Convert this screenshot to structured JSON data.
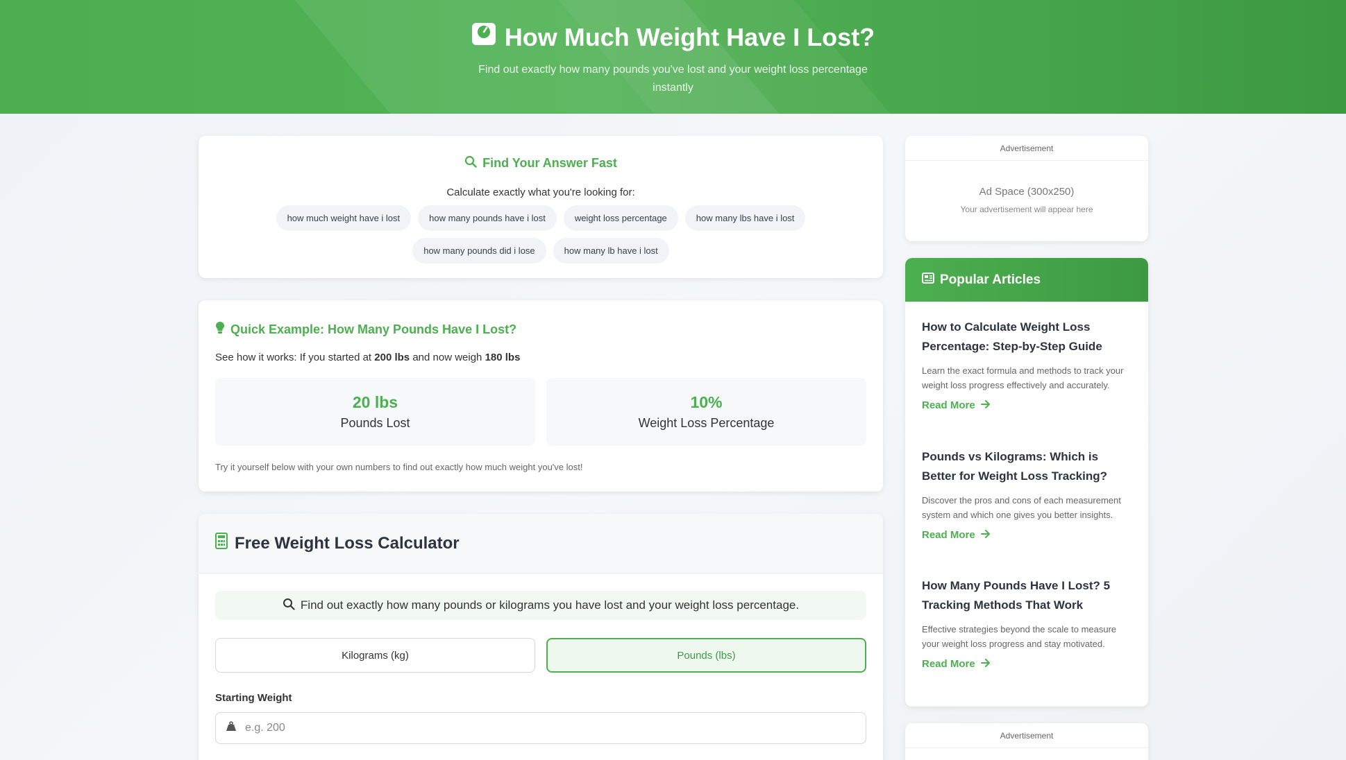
{
  "header": {
    "title": "How Much Weight Have I Lost?",
    "subtitle": "Find out exactly how many pounds you've lost and your weight loss percentage instantly"
  },
  "find_answer": {
    "heading": "Find Your Answer Fast",
    "lead": "Calculate exactly what you're looking for:",
    "chips": [
      "how much weight have i lost",
      "how many pounds have i lost",
      "weight loss percentage",
      "how many lbs have i lost",
      "how many pounds did i lose",
      "how many lb have i lost"
    ]
  },
  "example": {
    "heading": "Quick Example: How Many Pounds Have I Lost?",
    "desc_prefix": "See how it works: If you started at ",
    "start_weight": "200 lbs",
    "desc_middle": " and now weigh ",
    "current_weight": "180 lbs",
    "stat1_value": "20 lbs",
    "stat1_label": "Pounds Lost",
    "stat2_value": "10%",
    "stat2_label": "Weight Loss Percentage",
    "note": "Try it yourself below with your own numbers to find out exactly how much weight you've lost!"
  },
  "calculator": {
    "title": "Free Weight Loss Calculator",
    "info": "Find out exactly how many pounds or kilograms you have lost and your weight loss percentage.",
    "unit_kg": "Kilograms (kg)",
    "unit_lbs": "Pounds (lbs)",
    "selected_unit": "lbs",
    "starting_label": "Starting Weight",
    "starting_placeholder": "e.g. 200"
  },
  "sidebar": {
    "ad_label": "Advertisement",
    "ad_space": "Ad Space (300x250)",
    "ad_sub": "Your advertisement will appear here",
    "articles_heading": "Popular Articles",
    "articles": [
      {
        "title": "How to Calculate Weight Loss Percentage: Step-by-Step Guide",
        "desc": "Learn the exact formula and methods to track your weight loss progress effectively and accurately.",
        "link": "Read More"
      },
      {
        "title": "Pounds vs Kilograms: Which is Better for Weight Loss Tracking?",
        "desc": "Discover the pros and cons of each measurement system and which one gives you better insights.",
        "link": "Read More"
      },
      {
        "title": "How Many Pounds Have I Lost? 5 Tracking Methods That Work",
        "desc": "Effective strategies beyond the scale to measure your weight loss progress and stay motivated.",
        "link": "Read More"
      }
    ],
    "ad2_label": "Advertisement"
  },
  "colors": {
    "brand_green": "#4caf50",
    "brand_green_dark": "#3d9a42"
  },
  "icons": {
    "title": "weight-scale-icon",
    "find": "search-icon",
    "example": "lightbulb-icon",
    "calculator": "calculator-icon",
    "articles": "newspaper-icon",
    "field": "weight-icon",
    "read_more": "arrow-right-icon"
  }
}
